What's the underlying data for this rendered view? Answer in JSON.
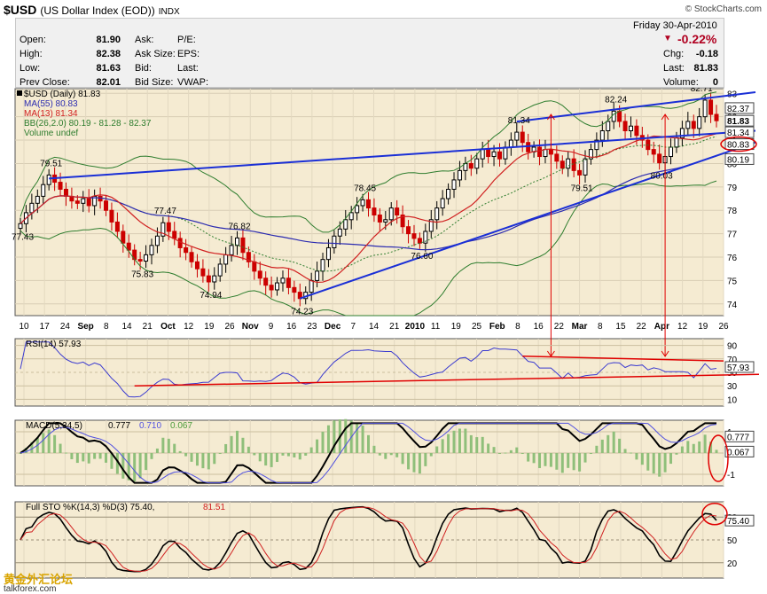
{
  "header": {
    "symbol": "$USD",
    "name": "(US Dollar Index (EOD))",
    "exchange": "INDX",
    "watermark": "© StockCharts.com",
    "date": "Friday  30-Apr-2010",
    "change_pct": "-0.22%"
  },
  "quote": {
    "open_label": "Open:",
    "open": "81.90",
    "high_label": "High:",
    "high": "82.38",
    "low_label": "Low:",
    "low": "81.63",
    "prev_label": "Prev Close:",
    "prev": "82.01",
    "ask_label": "Ask:",
    "ask_size_label": "Ask Size:",
    "bid_label": "Bid:",
    "bid_size_label": "Bid Size:",
    "pe_label": "P/E:",
    "eps_label": "EPS:",
    "last_label_l": "Last:",
    "vwap_label": "VWAP:",
    "chg_label": "Chg:",
    "chg": "-0.18",
    "last_label": "Last:",
    "last": "81.83",
    "volume_label": "Volume:",
    "volume": "0"
  },
  "legend": {
    "price": "$USD (Daily) 81.83",
    "ma55": "MA(55) 80.83",
    "ma13": "MA(13) 81.34",
    "bb": "BB(26,2.0) 80.19 - 81.28 - 82.37",
    "volume": "Volume undef",
    "rsi": "RSI(14) 57.93",
    "macd_name": "MACD(5,34,5)",
    "macd_v1": "0.777",
    "macd_v2": "0.710",
    "macd_v3": "0.067",
    "sto_name": "Full STO %K(14,3) %D(3) 75.40,",
    "sto_v2": "81.51"
  },
  "colors": {
    "panel_bg": "#f5ebd2",
    "up": "#000000",
    "down": "#cc0000",
    "ma55": "#2b2bb0",
    "ma13": "#d02020",
    "bb": "#2e7d2e",
    "trend": "#1a2fd6",
    "annot": "#e00000"
  },
  "watermark_cn": "黄金外汇论坛",
  "watermark_site": "talkforex.com",
  "chart_data": [
    {
      "type": "candlestick",
      "title": "$USD (US Dollar Index (EOD)) INDX",
      "ylim": [
        73.5,
        83.2
      ],
      "y_ticks": [
        74,
        75,
        76,
        77,
        78,
        79,
        80,
        81,
        82,
        83
      ],
      "x_labels": [
        "10",
        "17",
        "24",
        "Sep",
        "8",
        "14",
        "21",
        "Oct",
        "12",
        "19",
        "26",
        "Nov",
        "9",
        "16",
        "23",
        "Dec",
        "7",
        "14",
        "21",
        "2010",
        "11",
        "19",
        "25",
        "Feb",
        "8",
        "16",
        "22",
        "Mar",
        "8",
        "15",
        "22",
        "Apr",
        "12",
        "19",
        "26"
      ],
      "price_annotations": [
        "77.43",
        "79.51",
        "75.83",
        "77.47",
        "74.94",
        "76.82",
        "74.23",
        "78.45",
        "76.60",
        "81.34",
        "79.51",
        "82.24",
        "80.03",
        "82.71"
      ],
      "axis_tags": [
        "82.37",
        "81.83",
        "81.34",
        "80.83",
        "80.19"
      ],
      "closes": [
        77.43,
        77.9,
        78.3,
        78.6,
        79.1,
        79.51,
        79.2,
        78.9,
        78.6,
        78.4,
        78.3,
        78.5,
        78.2,
        78.6,
        78.4,
        78.0,
        77.5,
        77.1,
        76.6,
        76.3,
        75.9,
        75.83,
        76.1,
        76.5,
        76.9,
        77.47,
        77.1,
        76.8,
        76.4,
        76.2,
        75.8,
        75.5,
        75.2,
        74.94,
        75.2,
        75.7,
        76.1,
        76.5,
        76.82,
        76.2,
        75.8,
        75.4,
        75.1,
        74.8,
        74.6,
        74.9,
        75.1,
        74.7,
        74.5,
        74.23,
        74.5,
        75.0,
        75.4,
        75.9,
        76.4,
        76.9,
        77.2,
        77.6,
        77.9,
        78.2,
        78.45,
        78.1,
        77.8,
        77.5,
        77.6,
        78.1,
        77.8,
        77.3,
        77.0,
        76.8,
        76.6,
        77.1,
        77.6,
        78.1,
        78.5,
        78.9,
        79.3,
        79.7,
        80.0,
        79.8,
        80.2,
        80.6,
        80.3,
        80.5,
        80.2,
        80.7,
        81.0,
        81.34,
        80.9,
        80.5,
        80.7,
        80.3,
        80.6,
        80.4,
        80.1,
        79.8,
        80.2,
        79.7,
        79.51,
        80.2,
        80.6,
        81.0,
        81.4,
        81.8,
        82.24,
        81.8,
        81.4,
        81.6,
        81.2,
        81.0,
        80.6,
        80.4,
        80.03,
        80.3,
        80.7,
        81.1,
        81.5,
        81.8,
        81.5,
        82.0,
        82.71,
        82.1,
        81.83
      ]
    },
    {
      "type": "line",
      "title": "RSI(14) 57.93",
      "ylim": [
        0,
        100
      ],
      "y_ticks": [
        90,
        70,
        50,
        30,
        10
      ],
      "last": 57.93
    },
    {
      "type": "line",
      "title": "MACD(5,34,5)",
      "y_ticks": [
        1,
        0,
        -1
      ],
      "series_last": {
        "macd": 0.777,
        "signal": 0.71,
        "histogram": 0.067
      }
    },
    {
      "type": "line",
      "title": "Full STO %K(14,3) %D(3)",
      "ylim": [
        0,
        100
      ],
      "y_ticks": [
        80,
        50,
        20
      ],
      "series_last": {
        "k": 75.4,
        "d": 81.51
      }
    }
  ]
}
